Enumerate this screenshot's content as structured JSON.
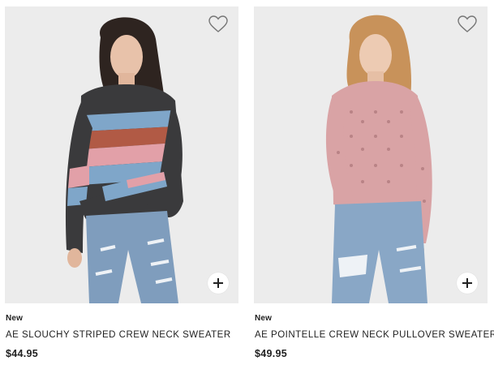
{
  "products": [
    {
      "badge": "New",
      "name": "AE SLOUCHY STRIPED CREW NECK SWEATER",
      "price": "$44.95",
      "image": "model wearing a slouchy striped crew neck sweater and ripped jeans",
      "favorite_icon": "heart-outline-icon",
      "add_icon": "plus-icon"
    },
    {
      "badge": "New",
      "name": "AE POINTELLE CREW NECK PULLOVER SWEATER",
      "price": "$49.95",
      "image": "model wearing a pink pointelle crew neck pullover sweater and ripped jeans",
      "favorite_icon": "heart-outline-icon",
      "add_icon": "plus-icon"
    }
  ],
  "colors": {
    "photo_background": "#ececec",
    "text": "#222222",
    "sweater_dark": "#3a3a3c",
    "sweater_blue": "#7fa6c9",
    "sweater_pink": "#e2a0a8",
    "sweater_rust": "#b15a45",
    "sweater_pointelle": "#d9a3a5",
    "denim": "#7f9dbd"
  }
}
